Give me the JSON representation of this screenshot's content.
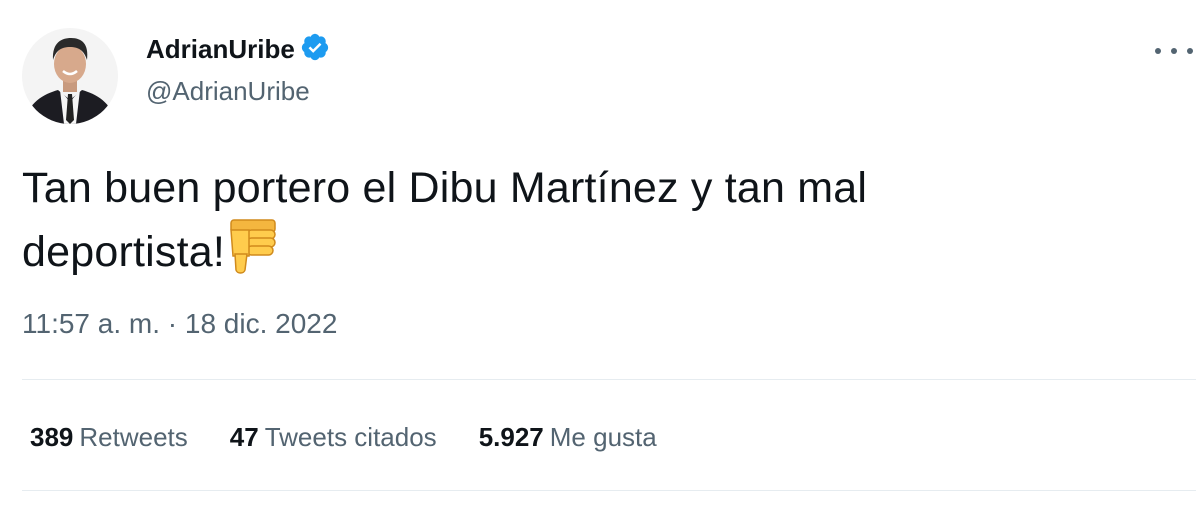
{
  "tweet": {
    "author": {
      "display_name": "AdrianUribe",
      "handle": "@AdrianUribe",
      "verified": true
    },
    "text": "Tan buen portero el Dibu Martínez y tan mal deportista!",
    "emoji": "thumbs-down",
    "timestamp": "11:57 a. m. · 18 dic. 2022",
    "stats": [
      {
        "count": "389",
        "label": "Retweets"
      },
      {
        "count": "47",
        "label": "Tweets citados"
      },
      {
        "count": "5.927",
        "label": "Me gusta"
      }
    ]
  },
  "colors": {
    "text": "#0f1419",
    "secondary": "#536471",
    "verified_badge": "#1d9bf0",
    "divider": "#e6ecf0"
  },
  "icons": {
    "verified": "verified-badge-icon",
    "more": "more-options-icon",
    "emoji": "thumbs-down-icon"
  }
}
